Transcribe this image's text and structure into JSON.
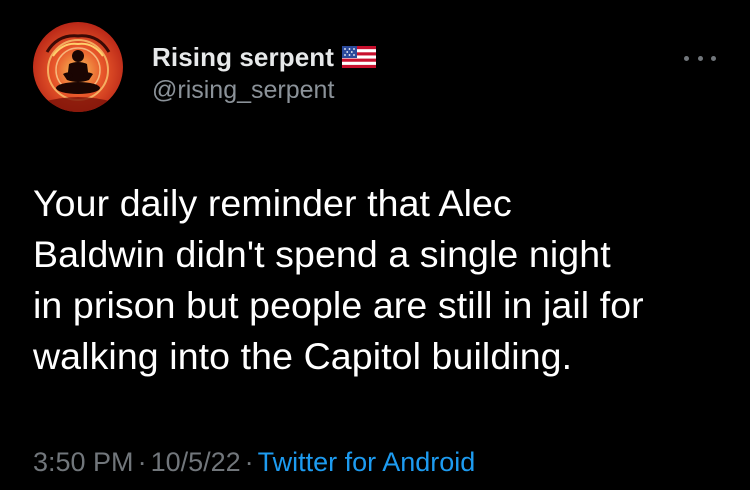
{
  "author": {
    "display_name": "Rising serpent",
    "handle": "@rising_serpent",
    "flag_icon": "us-flag-icon",
    "avatar_icon": "meditating-figure-avatar"
  },
  "tweet": {
    "text": "Your daily reminder that Alec\nBaldwin didn't spend a single night\nin prison but people are still in jail for\nwalking into the Capitol building."
  },
  "meta": {
    "time": "3:50 PM",
    "separator": "·",
    "date": "10/5/22",
    "source": "Twitter for Android"
  },
  "menu": {
    "icon": "more-options-icon"
  },
  "colors": {
    "background": "#000000",
    "text": "#ffffff",
    "secondary": "#71767b",
    "link": "#1d9bf0"
  }
}
